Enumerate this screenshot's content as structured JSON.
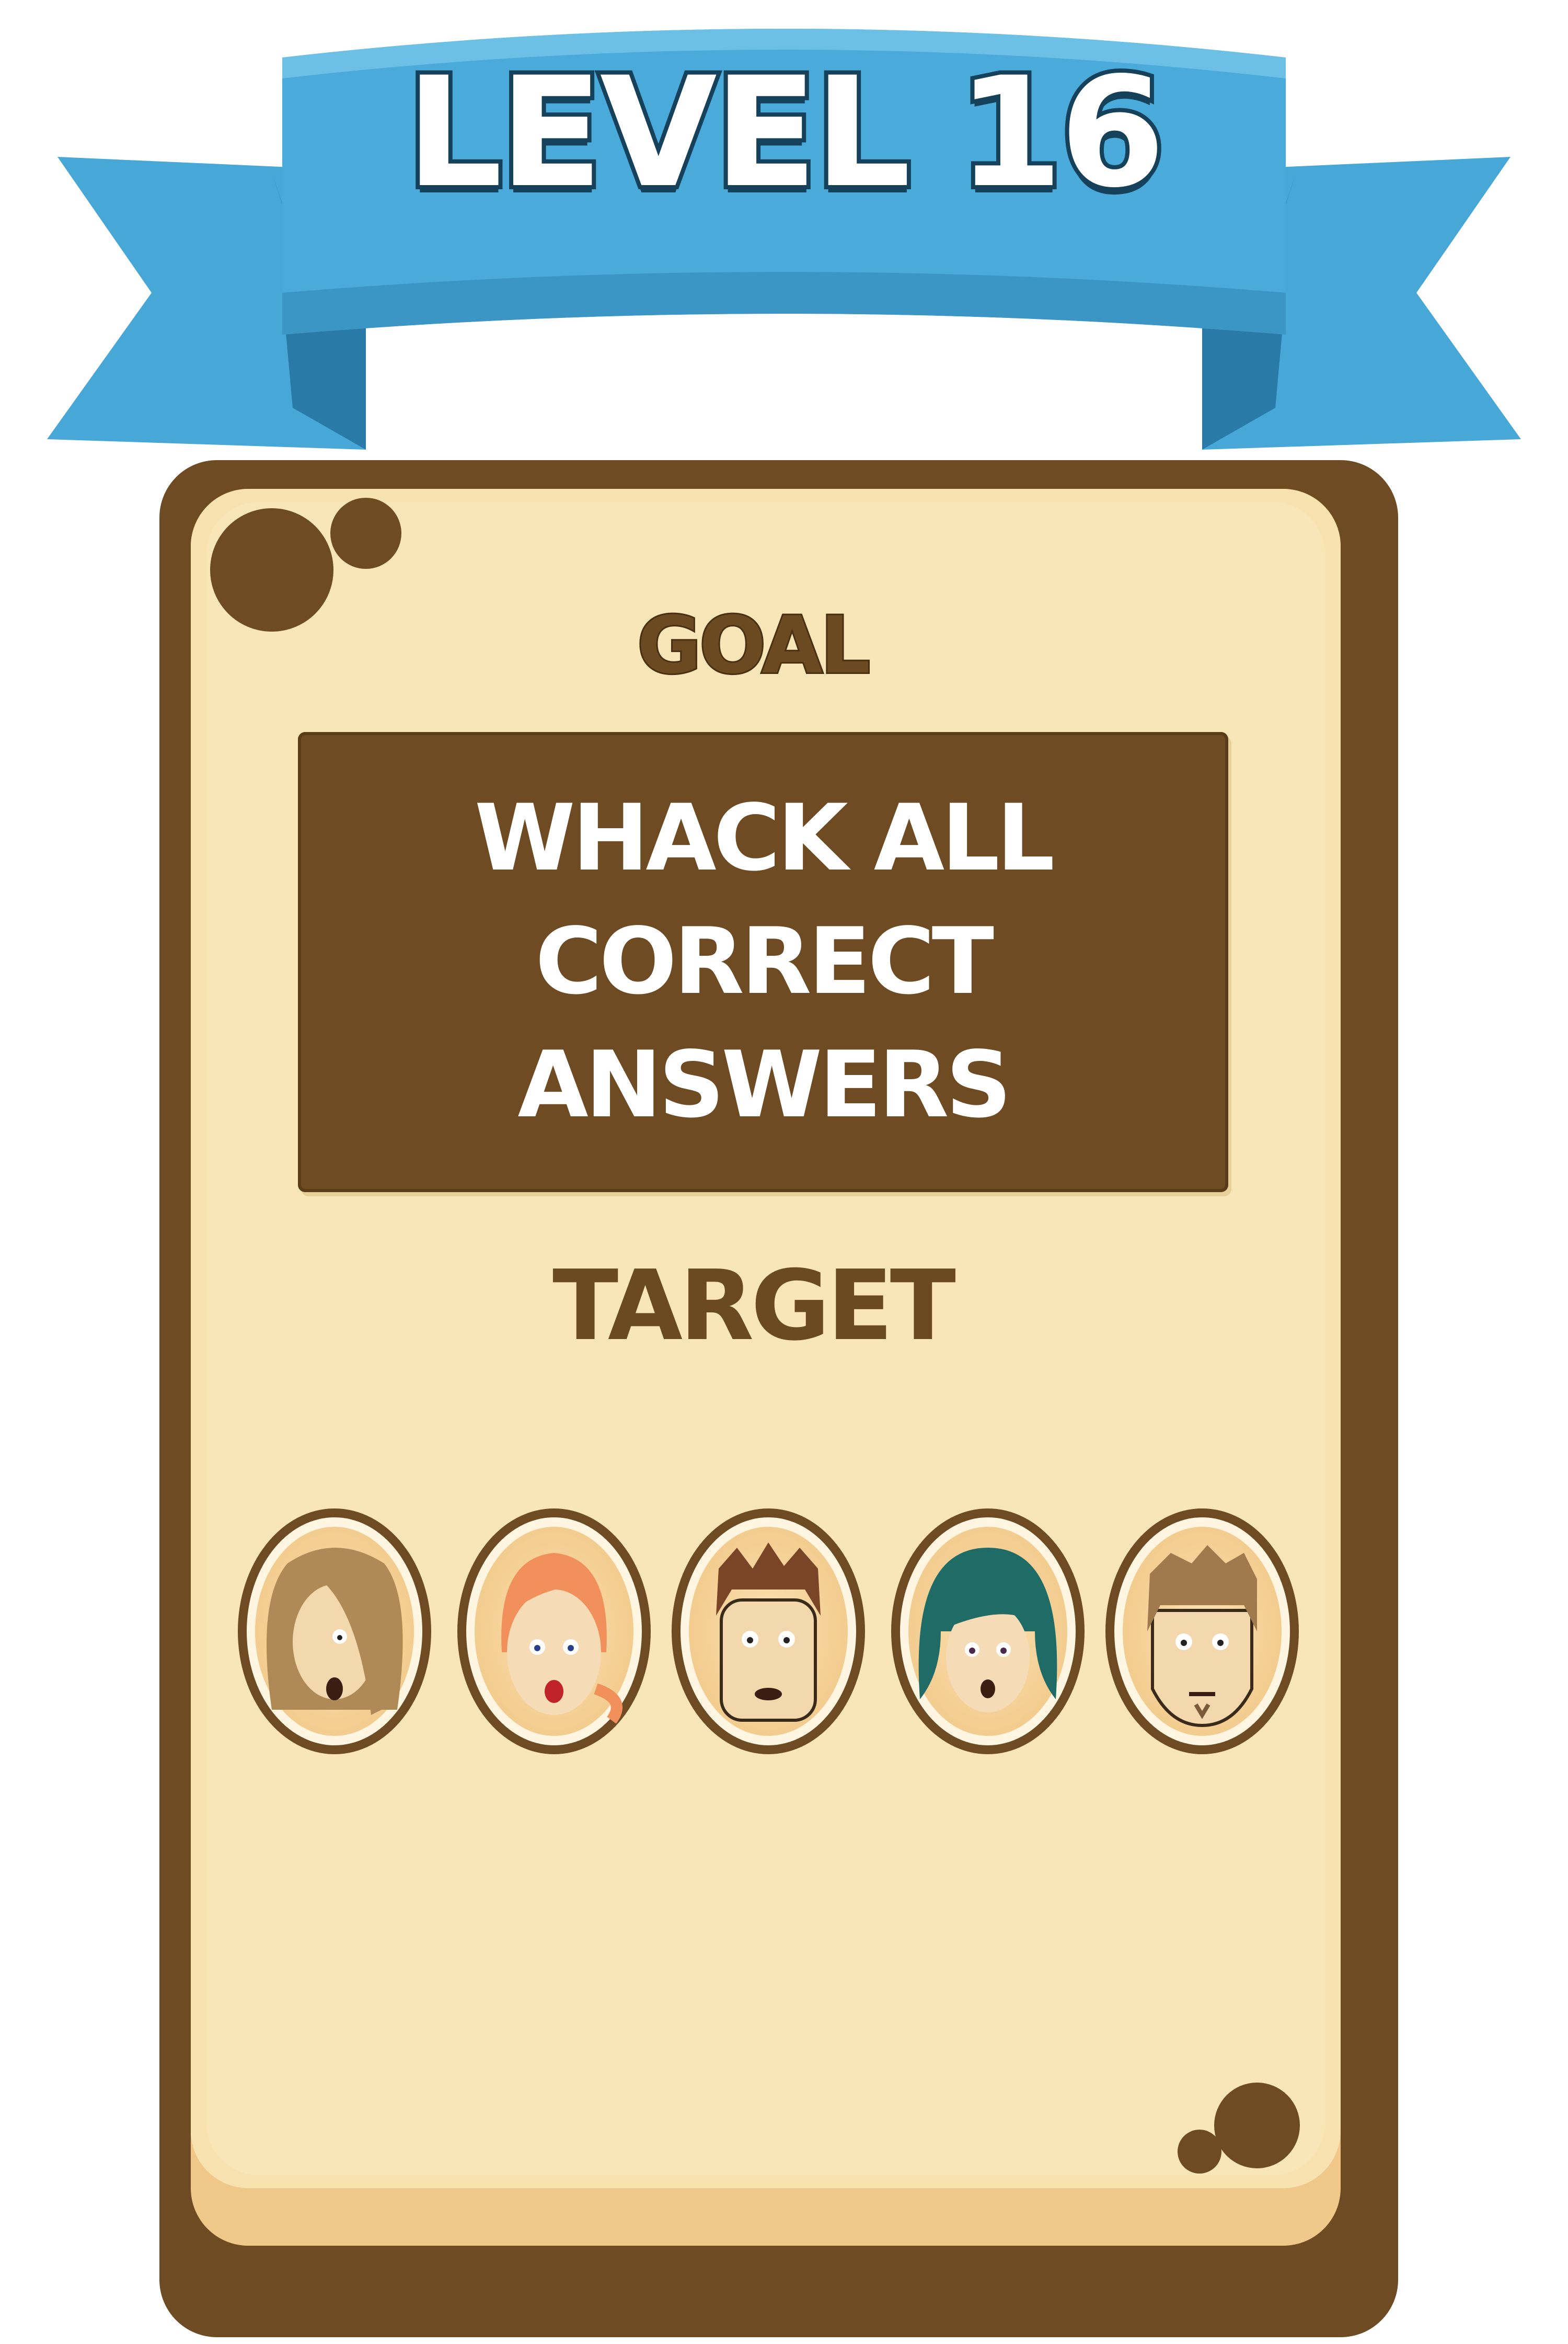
{
  "level": {
    "title": "LEVEL 16"
  },
  "goal": {
    "heading": "GOAL",
    "lines": [
      "WHACK ALL",
      "CORRECT ANSWERS"
    ]
  },
  "target": {
    "heading": "TARGET",
    "faces": [
      {
        "id": "face-1",
        "hair": "#b08a56",
        "skin": "#f3d7ad"
      },
      {
        "id": "face-2",
        "hair": "#f1905a",
        "skin": "#f6dcb6"
      },
      {
        "id": "face-3",
        "hair": "#7a4526",
        "skin": "#f3d7ad"
      },
      {
        "id": "face-4",
        "hair": "#1f6b66",
        "skin": "#f6dcb6"
      },
      {
        "id": "face-5",
        "hair": "#a07a4c",
        "skin": "#f3d7ad"
      }
    ]
  },
  "colors": {
    "ribbon": "#3fa4d4",
    "ribbon_dark": "#2c82b3",
    "card_border": "#6e4b22",
    "card_face": "#f7e3b3",
    "card_bottom": "#f0c88a"
  }
}
